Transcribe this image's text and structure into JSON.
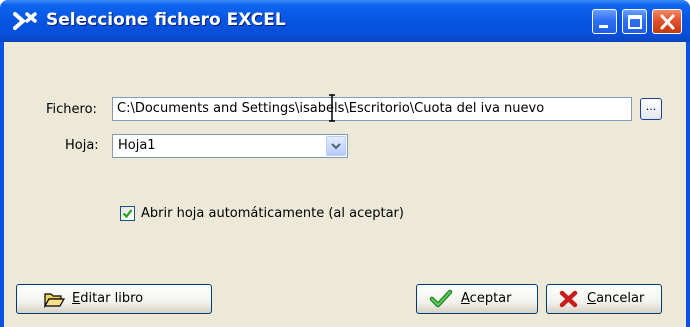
{
  "window": {
    "title": "Seleccione fichero EXCEL",
    "app_icon_glyph": "✕",
    "title_bar_color": "#0653e0",
    "close_button_color": "#e1522b"
  },
  "form": {
    "file_label": "Fichero:",
    "file_value": "C:\\Documents and Settings\\isabels\\Escritorio\\Cuota del iva nuevo",
    "browse_label": "...",
    "sheet_label": "Hoja:",
    "sheet_value": "Hoja1",
    "auto_open_label": "Abrir hoja automáticamente (al aceptar)",
    "auto_open_checked": true
  },
  "buttons": {
    "edit_book": "Editar libro",
    "accept": "Aceptar",
    "cancel": "Cancelar"
  },
  "icons": {
    "app": "x-logo-icon",
    "browse": "ellipsis-icon",
    "dropdown": "chevron-down-icon",
    "edit_book": "folder-open-icon",
    "accept": "checkmark-icon",
    "cancel": "red-x-icon"
  }
}
